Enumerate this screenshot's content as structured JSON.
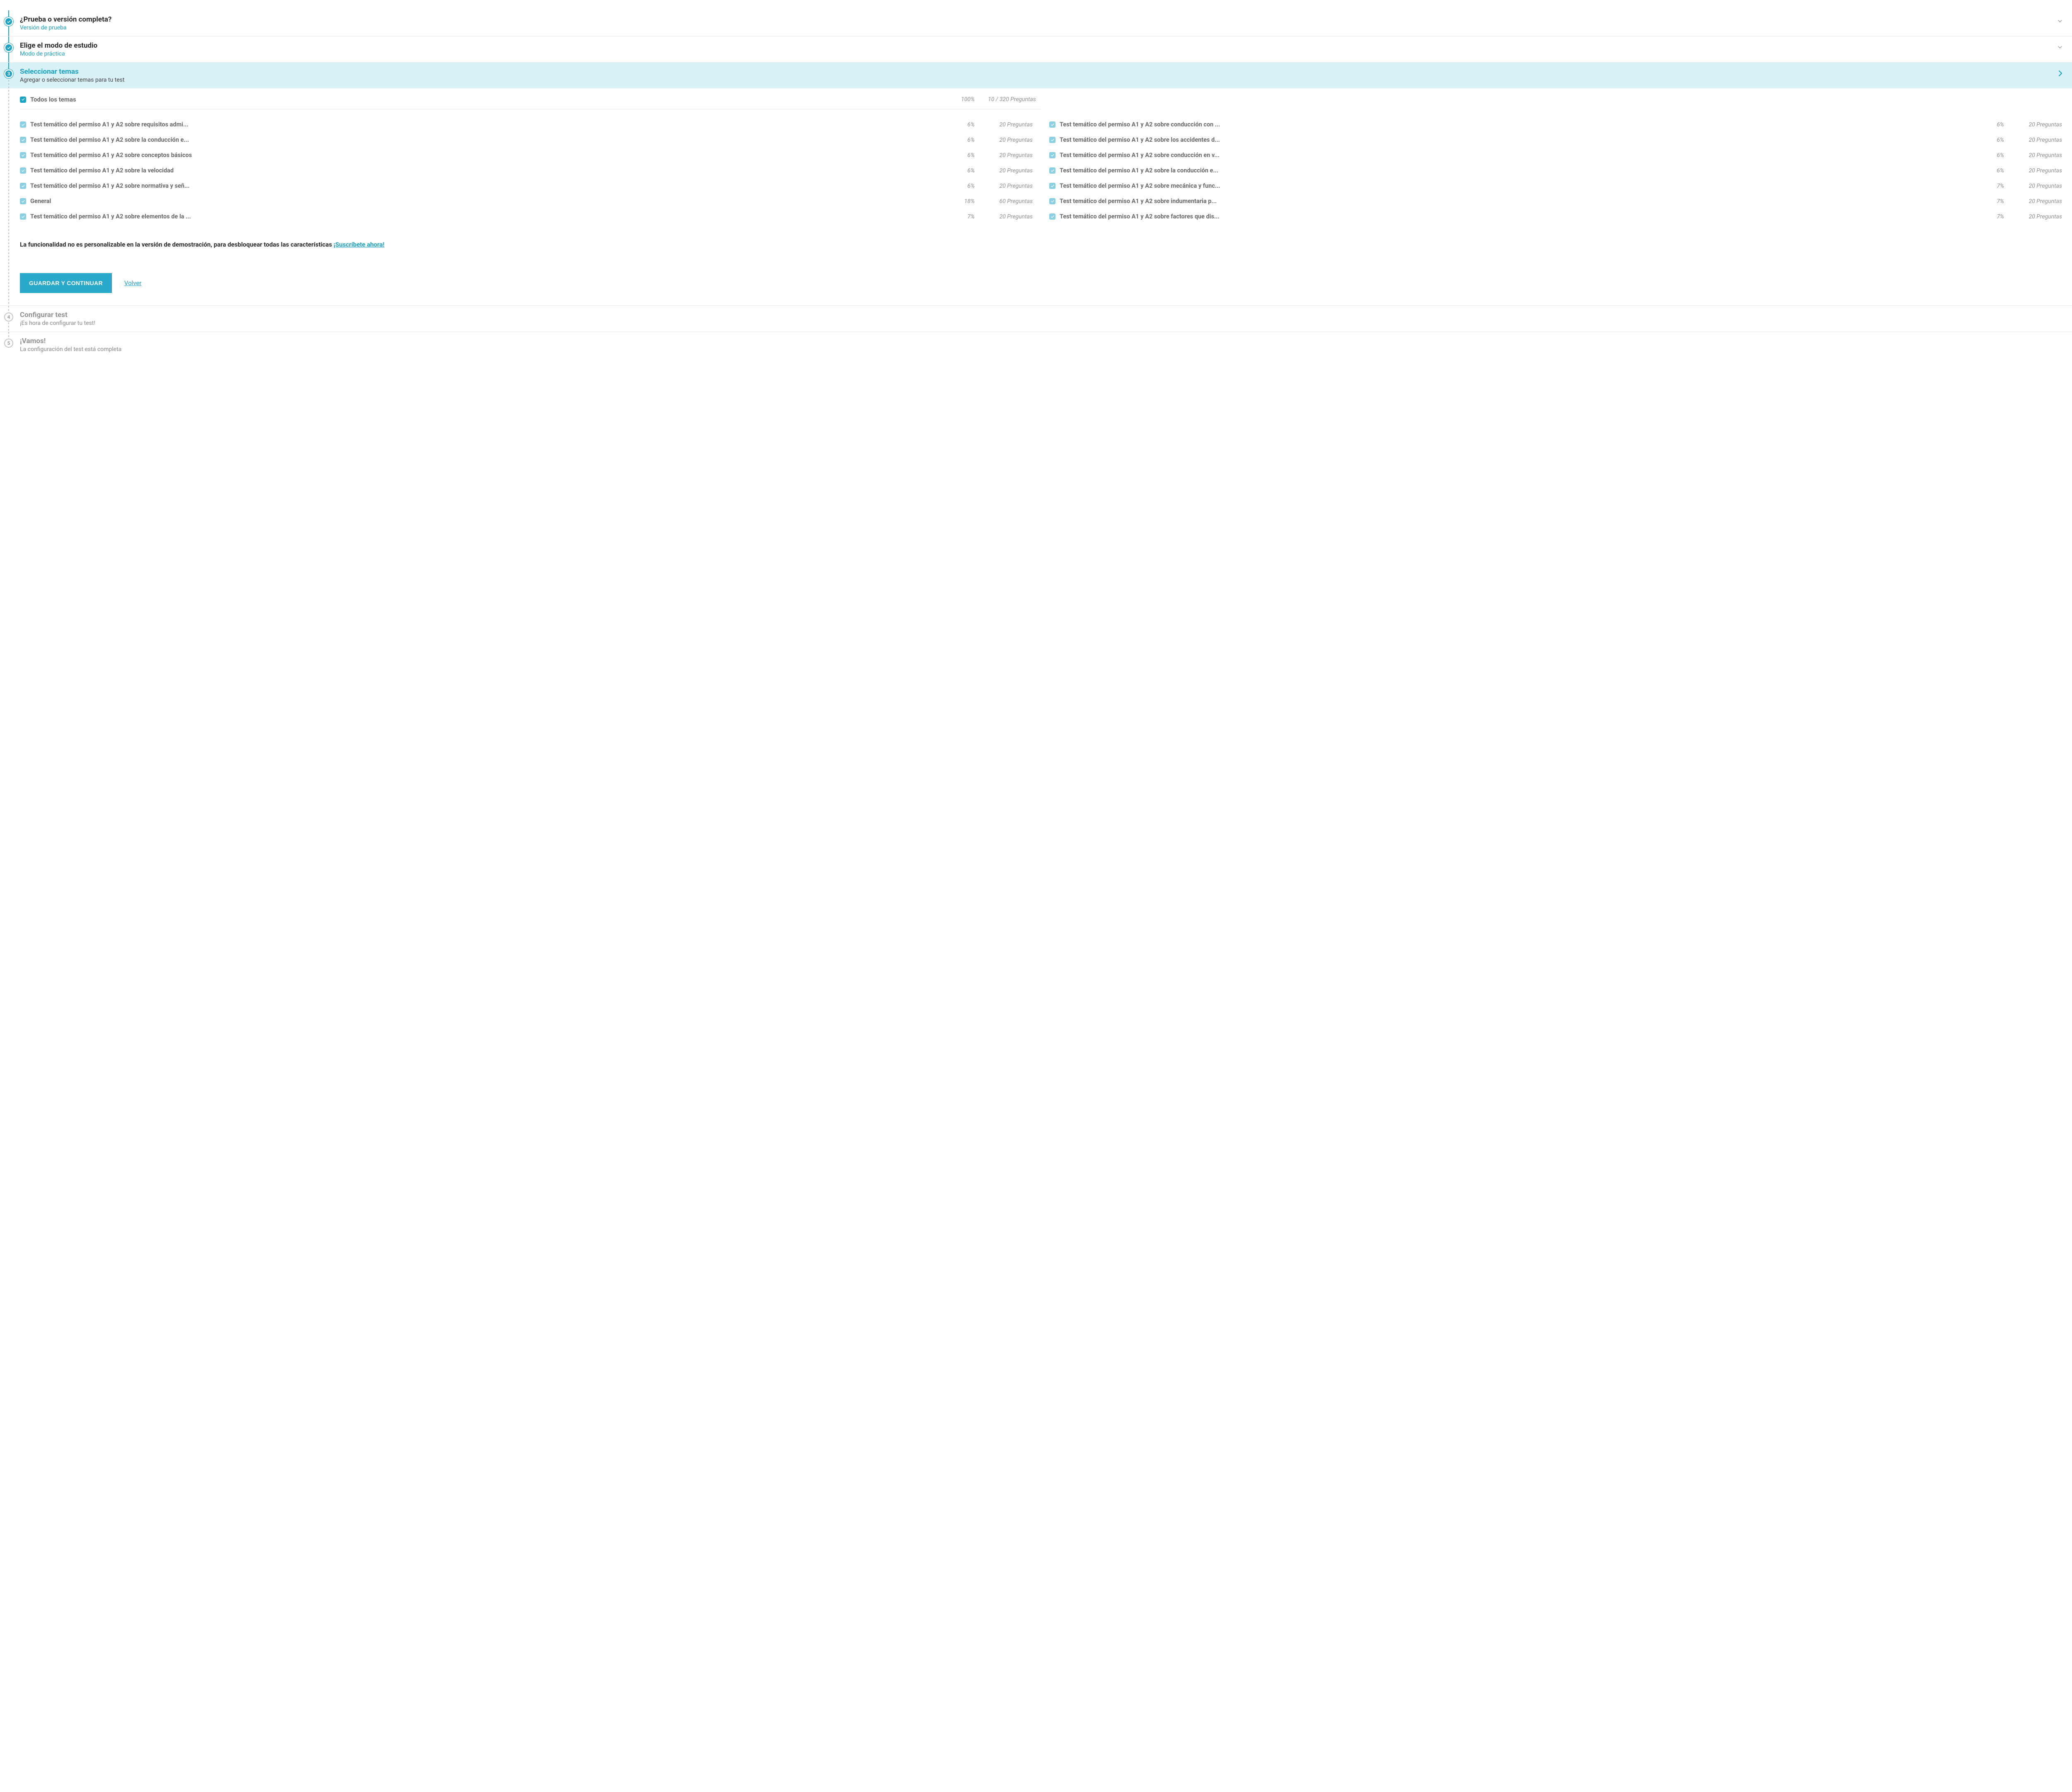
{
  "steps": {
    "s1": {
      "title": "¿Prueba o versión completa?",
      "subtitle": "Versión de prueba"
    },
    "s2": {
      "title": "Elige el modo de estudio",
      "subtitle": "Modo de práctica"
    },
    "s3": {
      "title": "Seleccionar temas",
      "subtitle": "Agregar o seleccionar temas para tu test",
      "marker": "3"
    },
    "s4": {
      "title": "Configurar test",
      "subtitle": "¡Es hora de configurar tu test!",
      "marker": "4"
    },
    "s5": {
      "title": "¡Vamos!",
      "subtitle": "La configuración del test está completa",
      "marker": "5"
    }
  },
  "topics": {
    "all_label": "Todos los temas",
    "all_pct": "100%",
    "all_count": "10 / 320 Preguntas",
    "left": [
      {
        "label": "Test temático del permiso A1 y A2 sobre requisitos admi...",
        "pct": "6%",
        "count": "20 Preguntas"
      },
      {
        "label": "Test temático del permiso A1 y A2 sobre la conducción e...",
        "pct": "6%",
        "count": "20 Preguntas"
      },
      {
        "label": "Test temático del permiso A1 y A2 sobre conceptos básicos",
        "pct": "6%",
        "count": "20 Preguntas"
      },
      {
        "label": "Test temático del permiso A1 y A2 sobre la velocidad",
        "pct": "6%",
        "count": "20 Preguntas"
      },
      {
        "label": "Test temático del permiso A1 y A2 sobre normativa y señ...",
        "pct": "6%",
        "count": "20 Preguntas"
      },
      {
        "label": "General",
        "pct": "18%",
        "count": "60 Preguntas"
      },
      {
        "label": "Test temático del permiso A1 y A2 sobre elementos de la ...",
        "pct": "7%",
        "count": "20 Preguntas"
      }
    ],
    "right": [
      {
        "label": "Test temático del permiso A1 y A2 sobre conducción con ...",
        "pct": "6%",
        "count": "20 Preguntas"
      },
      {
        "label": "Test temático del permiso A1 y A2 sobre los accidentes d...",
        "pct": "6%",
        "count": "20 Preguntas"
      },
      {
        "label": "Test temático del permiso A1 y A2 sobre conducción en v...",
        "pct": "6%",
        "count": "20 Preguntas"
      },
      {
        "label": "Test temático del permiso A1 y A2 sobre la conducción e...",
        "pct": "6%",
        "count": "20 Preguntas"
      },
      {
        "label": "Test temático del permiso A1 y A2 sobre mecánica y func...",
        "pct": "7%",
        "count": "20 Preguntas"
      },
      {
        "label": "Test temático del permiso A1 y A2 sobre indumentaria p...",
        "pct": "7%",
        "count": "20 Preguntas"
      },
      {
        "label": "Test temático del permiso A1 y A2 sobre factores que dis...",
        "pct": "7%",
        "count": "20 Preguntas"
      }
    ]
  },
  "demo_notice": {
    "text": "La funcionalidad no es personalizable en la versión de demostración, para desbloquear todas las características ",
    "link": "¡Suscríbete ahora!"
  },
  "actions": {
    "save": "GUARDAR Y CONTINUAR",
    "back": "Volver"
  }
}
